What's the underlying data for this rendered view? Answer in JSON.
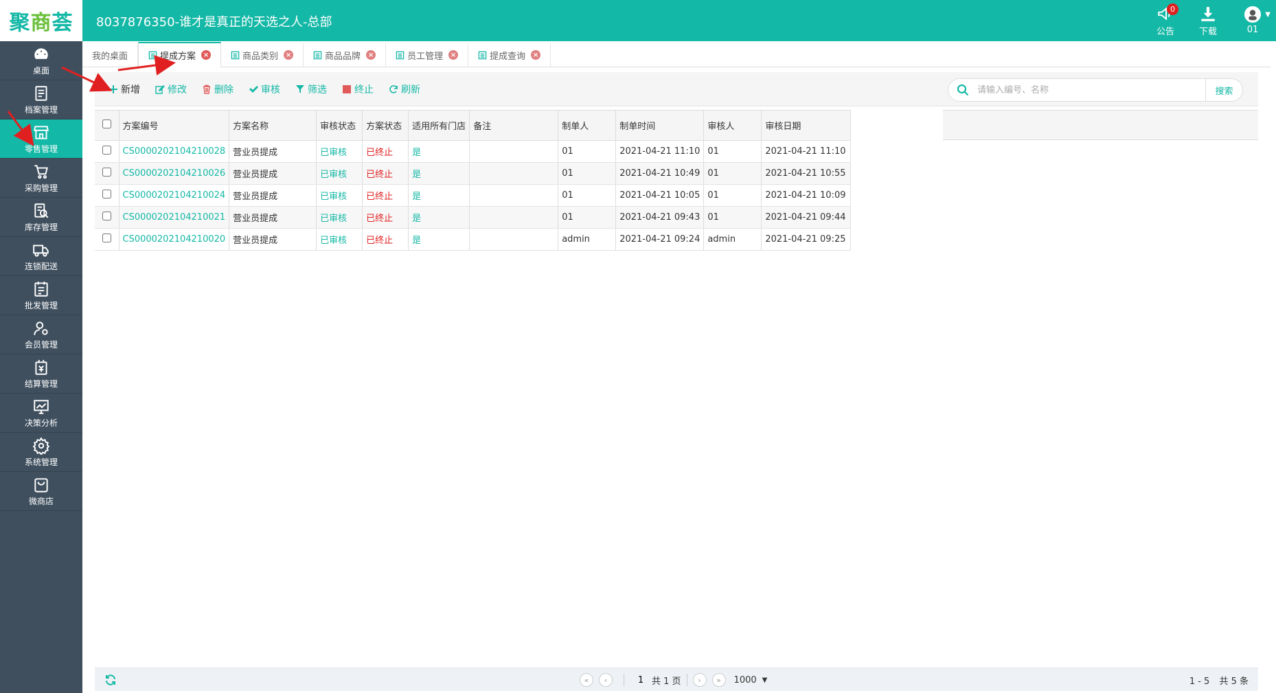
{
  "header": {
    "logo_text_a": "聚",
    "logo_text_b": "商",
    "logo_text_c": "荟",
    "title": "8037876350-谁才是真正的天选之人-总部",
    "notice_label": "公告",
    "notice_count": "0",
    "download_label": "下载",
    "user_label": "01"
  },
  "sidebar": {
    "items": [
      {
        "label": "桌面",
        "icon": "dashboard-icon"
      },
      {
        "label": "档案管理",
        "icon": "archive-icon"
      },
      {
        "label": "零售管理",
        "icon": "store-icon"
      },
      {
        "label": "采购管理",
        "icon": "cart-icon"
      },
      {
        "label": "库存管理",
        "icon": "inventory-icon"
      },
      {
        "label": "连锁配送",
        "icon": "truck-icon"
      },
      {
        "label": "批发管理",
        "icon": "wholesale-icon"
      },
      {
        "label": "会员管理",
        "icon": "member-icon"
      },
      {
        "label": "结算管理",
        "icon": "settlement-icon"
      },
      {
        "label": "决策分析",
        "icon": "chart-icon"
      },
      {
        "label": "系统管理",
        "icon": "gear-icon"
      },
      {
        "label": "微商店",
        "icon": "bag-icon"
      }
    ],
    "active_index": 2
  },
  "tabs": [
    {
      "label": "我的桌面",
      "closable": false
    },
    {
      "label": "提成方案",
      "closable": true,
      "active": true
    },
    {
      "label": "商品类别",
      "closable": true
    },
    {
      "label": "商品品牌",
      "closable": true
    },
    {
      "label": "员工管理",
      "closable": true
    },
    {
      "label": "提成查询",
      "closable": true
    }
  ],
  "toolbar": {
    "add": "新增",
    "edit": "修改",
    "delete": "删除",
    "audit": "审核",
    "filter": "筛选",
    "stop": "终止",
    "refresh": "刷新",
    "search_placeholder": "请输入编号、名称",
    "search_button": "搜索"
  },
  "table": {
    "columns": [
      "方案编号",
      "方案名称",
      "审核状态",
      "方案状态",
      "适用所有门店",
      "备注",
      "制单人",
      "制单时间",
      "审核人",
      "审核日期"
    ],
    "rows": [
      [
        "CS0000202104210028",
        "营业员提成",
        "已审核",
        "已终止",
        "是",
        "",
        "01",
        "2021-04-21 11:10",
        "01",
        "2021-04-21 11:10"
      ],
      [
        "CS0000202104210026",
        "营业员提成",
        "已审核",
        "已终止",
        "是",
        "",
        "01",
        "2021-04-21 10:49",
        "01",
        "2021-04-21 10:55"
      ],
      [
        "CS0000202104210024",
        "营业员提成",
        "已审核",
        "已终止",
        "是",
        "",
        "01",
        "2021-04-21 10:05",
        "01",
        "2021-04-21 10:09"
      ],
      [
        "CS0000202104210021",
        "营业员提成",
        "已审核",
        "已终止",
        "是",
        "",
        "01",
        "2021-04-21 09:43",
        "01",
        "2021-04-21 09:44"
      ],
      [
        "CS0000202104210020",
        "营业员提成",
        "已审核",
        "已终止",
        "是",
        "",
        "admin",
        "2021-04-21 09:24",
        "admin",
        "2021-04-21 09:25"
      ]
    ]
  },
  "pager": {
    "page": "1",
    "total_pages_text": "共 1 页",
    "page_size": "1000",
    "range_text": "1 - 5",
    "total_text": "共 5 条"
  },
  "colors": {
    "brand": "#14b8a6",
    "sidebar": "#3f4f5e",
    "danger": "#e02020"
  }
}
